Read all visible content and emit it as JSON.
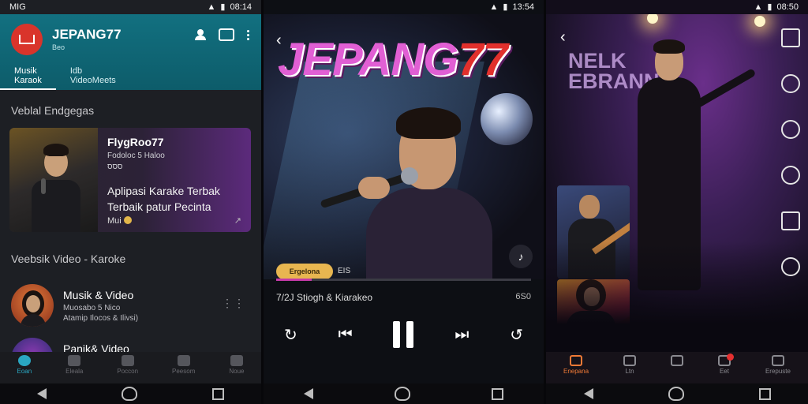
{
  "screen1": {
    "status": {
      "left": "MIG",
      "time": "08:14"
    },
    "app": {
      "title": "JEPANG77",
      "subtitle": "Beo"
    },
    "tabs": [
      {
        "label": "Musik\nKaraok"
      },
      {
        "label": "Idb\nVideoMeets"
      }
    ],
    "section1": "Veblal Endgegas",
    "featured": {
      "title": "FlygRoo77",
      "sub1": "Fodoloc 5 Haloo",
      "sub2": "ססס",
      "desc": "Aplipasi Karake Terbak Terbaik patur Pecinta",
      "meta": "Mui"
    },
    "section2": "Veebsik Video - Karoke",
    "list": [
      {
        "title": "Musik & Video",
        "sub": "Muosabo 5 Nico\nAtamip Ilocos & Ilivsi)"
      },
      {
        "title": "Panik& Video",
        "sub": ""
      }
    ],
    "bottom_nav": [
      "Eoan",
      "Eleala",
      "Poccon",
      "Peesom",
      "Noue"
    ]
  },
  "screen2": {
    "status": {
      "time": "13:54"
    },
    "brand": {
      "main": "JEPANG",
      "num": "77"
    },
    "badge": "Ergelona",
    "badge_code": "EIS",
    "progress": 0.14,
    "track": "7/2J Stiogh & Kiarakeo",
    "time": "6S0"
  },
  "screen3": {
    "status": {
      "time": "08:50"
    },
    "stage_sign": "NELK\nEBRANN",
    "bottom_nav": [
      "Enepana",
      "Ltn",
      "",
      "Eet",
      "Erepuste"
    ]
  }
}
